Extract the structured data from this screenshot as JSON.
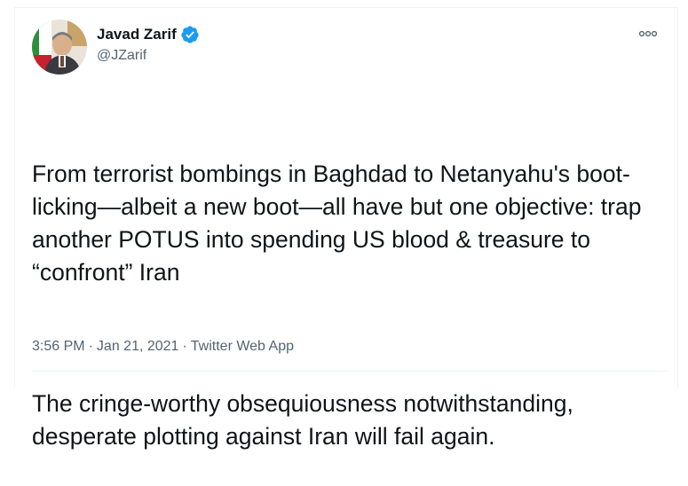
{
  "author": {
    "display_name": "Javad Zarif",
    "handle": "@JZarif",
    "verified": true,
    "avatar_icon": "profile-photo-icon"
  },
  "tweet": {
    "paragraphs": [
      "From terrorist bombings in Baghdad to Netanyahu's boot-licking—albeit a new boot—all have but one objective: trap another POTUS into spending US blood & treasure to “confront” Iran",
      "The cringe-worthy obsequiousness notwithstanding, desperate plotting against Iran will fail again."
    ]
  },
  "meta": {
    "time": "3:56 PM",
    "date": "Jan 21, 2021",
    "source": "Twitter Web App",
    "separator": "·"
  },
  "colors": {
    "text_primary": "#0f1419",
    "text_secondary": "#536471",
    "verified_blue": "#1d9bf0",
    "border": "#eff3f4"
  },
  "icons": {
    "more": "more-options-icon",
    "verified": "verified-badge-icon"
  }
}
